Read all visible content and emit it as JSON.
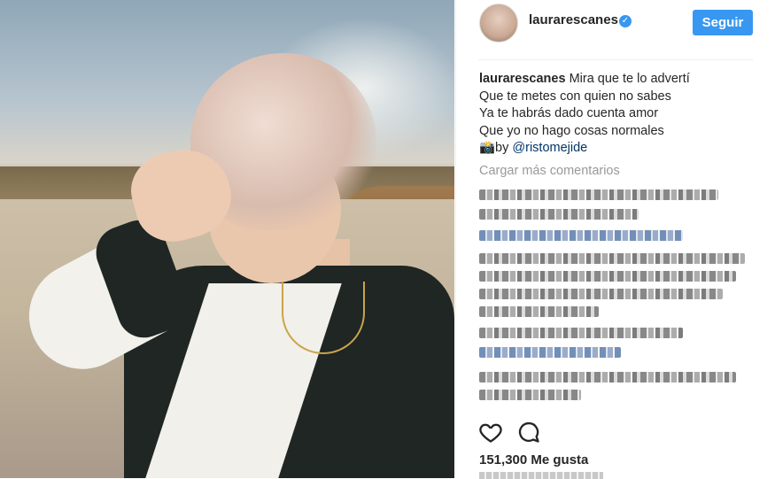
{
  "post": {
    "username": "laurarescanes",
    "follow_label": "Seguir",
    "caption": {
      "user": "laurarescanes",
      "lines": [
        "Mira que te lo advertí",
        "Que te metes con quien no sabes",
        "Ya te habrás dado cuenta amor",
        "Que yo no hago cosas normales"
      ],
      "credit_prefix": "📸by ",
      "mention": "@ristomejide"
    },
    "load_more": "Cargar más comentarios",
    "likes": "151,300 Me gusta"
  },
  "colors": {
    "accent": "#3897f0",
    "text": "#262626",
    "muted": "#999999",
    "mention": "#003569"
  },
  "icons": {
    "like": "heart-icon",
    "comment": "comment-icon",
    "verified": "verified-badge-icon"
  }
}
